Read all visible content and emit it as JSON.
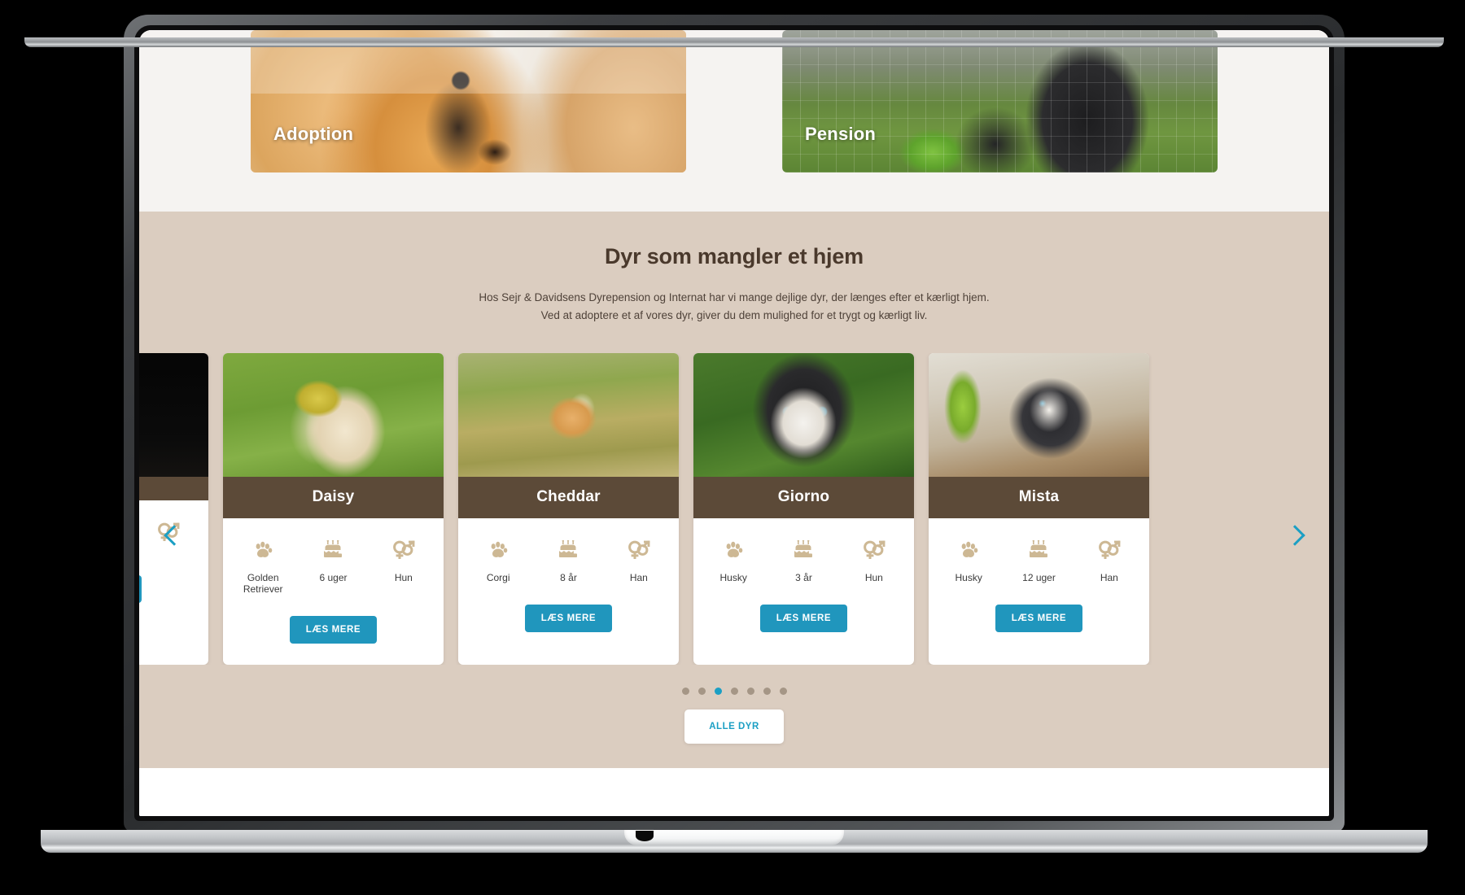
{
  "banners": [
    {
      "label": "Adoption",
      "photo": "golden-retriever-closeup"
    },
    {
      "label": "Pension",
      "photo": "dogs-in-fenced-yard"
    }
  ],
  "adoption_section": {
    "title": "Dyr som mangler et hjem",
    "description_line1": "Hos Sejr & Davidsens Dyrepension og Internat har vi mange dejlige dyr, der længes efter et kærligt hjem.",
    "description_line2": "Ved at adoptere et af vores dyr, giver du dem mulighed for et trygt og kærligt liv.",
    "read_more_label": "LÆS MERE",
    "all_animals_label": "ALLE DYR",
    "prev_arrow": "chevron-left",
    "next_arrow": "chevron-right",
    "dots_total": 7,
    "dots_active_index": 2,
    "icons": {
      "breed": "paw-icon",
      "age": "birthday-cake-icon",
      "gender": "gender-icon"
    },
    "pets": [
      {
        "name": "",
        "breed": "",
        "age": "",
        "gender": "",
        "photo": "dark-partial"
      },
      {
        "name": "Daisy",
        "breed": "Golden Retriever",
        "age": "6 uger",
        "gender": "Hun",
        "photo": "golden-retriever-ball"
      },
      {
        "name": "Cheddar",
        "breed": "Corgi",
        "age": "8 år",
        "gender": "Han",
        "photo": "corgi-in-grass"
      },
      {
        "name": "Giorno",
        "breed": "Husky",
        "age": "3 år",
        "gender": "Hun",
        "photo": "husky-blue-eyes"
      },
      {
        "name": "Mista",
        "breed": "Husky",
        "age": "12 uger",
        "gender": "Han",
        "photo": "husky-puppy-indoor"
      }
    ]
  },
  "colors": {
    "accent_blue": "#1b9fc4",
    "button_blue": "#2096bd",
    "section_bg": "#dbcdc0",
    "name_bar_brown": "#5c4a38",
    "title_brown": "#4a392c",
    "icon_tan": "#cdb894",
    "strip_bg": "#f5f3f1"
  }
}
